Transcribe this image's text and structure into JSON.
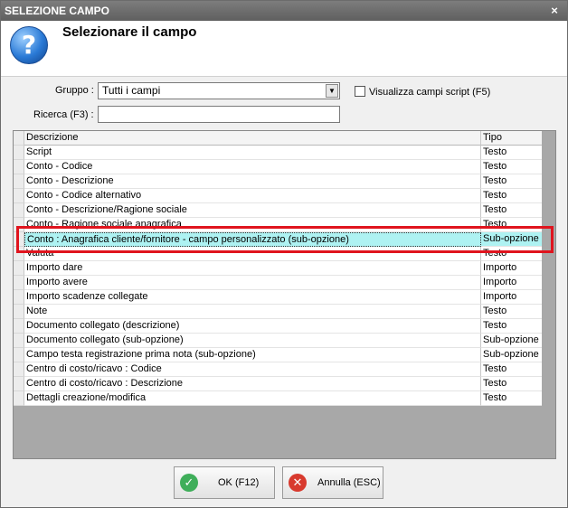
{
  "window": {
    "title": "SELEZIONE CAMPO",
    "close_glyph": "×"
  },
  "header": {
    "title": "Selezionare il campo",
    "icon": "question-icon",
    "icon_glyph": "?"
  },
  "form": {
    "gruppo_label": "Gruppo :",
    "gruppo_value": "Tutti i campi",
    "ricerca_label": "Ricerca (F3) :",
    "ricerca_value": "",
    "checkbox_label": "Visualizza campi script (F5)",
    "checkbox_checked": false
  },
  "grid": {
    "columns": [
      "Descrizione",
      "Tipo"
    ],
    "selected_index": 6,
    "rows": [
      {
        "descrizione": "Script",
        "tipo": "Testo"
      },
      {
        "descrizione": "Conto - Codice",
        "tipo": "Testo"
      },
      {
        "descrizione": "Conto - Descrizione",
        "tipo": "Testo"
      },
      {
        "descrizione": "Conto - Codice alternativo",
        "tipo": "Testo"
      },
      {
        "descrizione": "Conto - Descrizione/Ragione sociale",
        "tipo": "Testo"
      },
      {
        "descrizione": "Conto - Ragione sociale anagrafica",
        "tipo": "Testo"
      },
      {
        "descrizione": "Conto : Anagrafica cliente/fornitore - campo personalizzato (sub-opzione)",
        "tipo": "Sub-opzione"
      },
      {
        "descrizione": "Valuta",
        "tipo": "Testo"
      },
      {
        "descrizione": "Importo dare",
        "tipo": "Importo"
      },
      {
        "descrizione": "Importo avere",
        "tipo": "Importo"
      },
      {
        "descrizione": "Importo scadenze collegate",
        "tipo": "Importo"
      },
      {
        "descrizione": "Note",
        "tipo": "Testo"
      },
      {
        "descrizione": "Documento collegato (descrizione)",
        "tipo": "Testo"
      },
      {
        "descrizione": "Documento collegato (sub-opzione)",
        "tipo": "Sub-opzione"
      },
      {
        "descrizione": "Campo testa registrazione prima nota (sub-opzione)",
        "tipo": "Sub-opzione"
      },
      {
        "descrizione": "Centro di costo/ricavo : Codice",
        "tipo": "Testo"
      },
      {
        "descrizione": "Centro di costo/ricavo : Descrizione",
        "tipo": "Testo"
      },
      {
        "descrizione": "Dettagli creazione/modifica",
        "tipo": "Testo"
      }
    ]
  },
  "buttons": {
    "ok_label": "OK (F12)",
    "cancel_label": "Annulla (ESC)",
    "ok_color": "#3fae5a",
    "cancel_color": "#d83a2e"
  }
}
